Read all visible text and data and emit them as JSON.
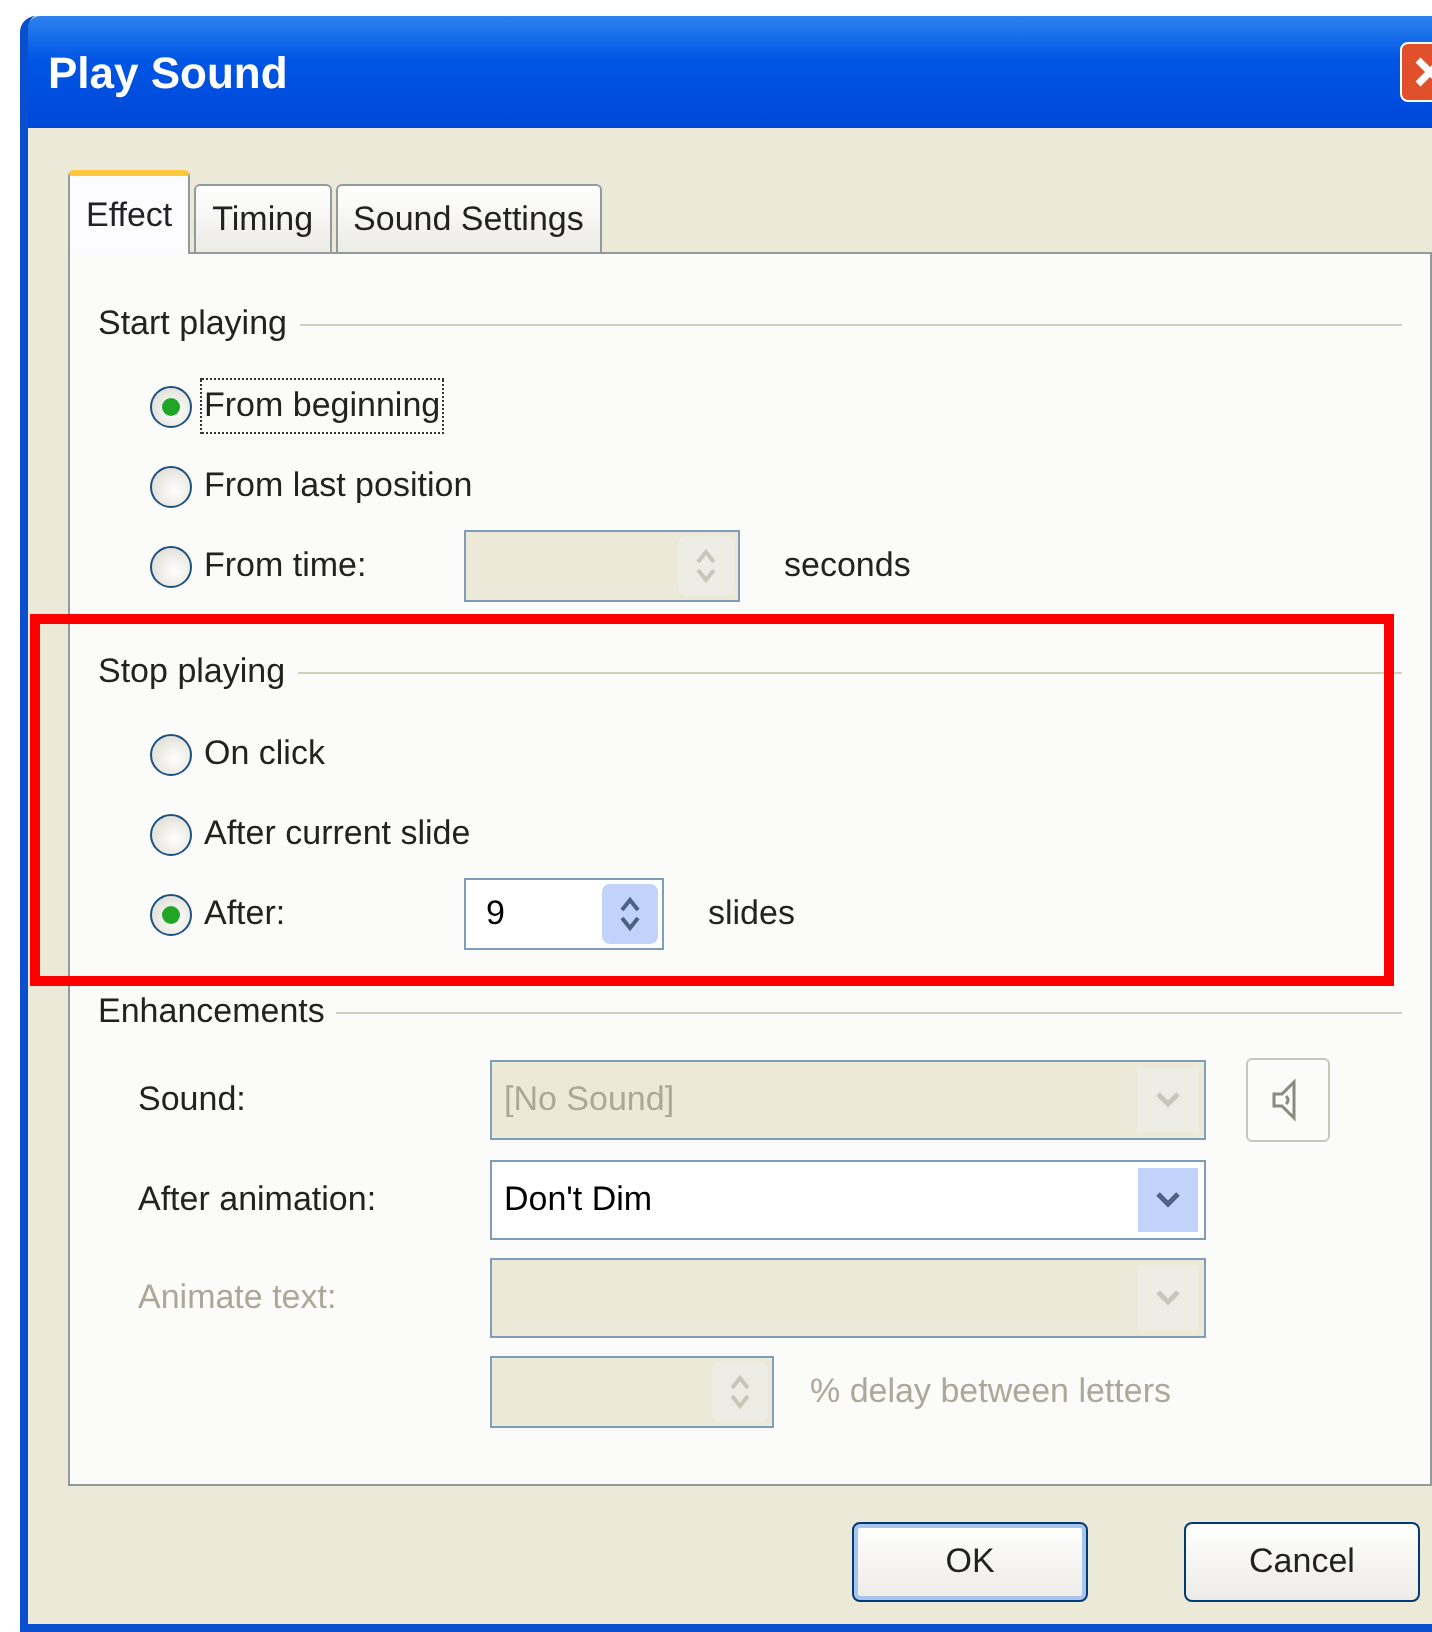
{
  "window": {
    "title": "Play Sound"
  },
  "tabs": [
    {
      "label": "Effect",
      "selected": true
    },
    {
      "label": "Timing",
      "selected": false
    },
    {
      "label": "Sound Settings",
      "selected": false
    }
  ],
  "start_playing": {
    "title": "Start playing",
    "options": [
      {
        "label": "From beginning",
        "selected": true,
        "focused": true
      },
      {
        "label": "From last position",
        "selected": false,
        "focused": false
      },
      {
        "label": "From time:",
        "selected": false,
        "focused": false,
        "spin": {
          "disabled": true
        },
        "suffix": "seconds"
      }
    ]
  },
  "stop_playing": {
    "title": "Stop playing",
    "highlighted": true,
    "options": [
      {
        "label": "On click",
        "selected": false,
        "focused": false
      },
      {
        "label": "After current slide",
        "selected": false,
        "focused": false
      },
      {
        "label": "After:",
        "selected": true,
        "focused": false,
        "spin": {
          "value": "9",
          "disabled": false
        },
        "suffix": "slides"
      }
    ]
  },
  "enhancements": {
    "title": "Enhancements",
    "rows": [
      {
        "label": "Sound:",
        "kind": "dropdown",
        "value": "[No Sound]",
        "disabled": true,
        "preview": {
          "disabled": true
        }
      },
      {
        "label": "After animation:",
        "kind": "dropdown",
        "value": "Don't Dim",
        "disabled": false
      },
      {
        "label": "Animate text:",
        "kind": "dropdown",
        "disabled": true
      }
    ],
    "delay": {
      "disabled": true,
      "suffix": "% delay between letters"
    }
  },
  "buttons": [
    {
      "label": "OK",
      "default": true
    },
    {
      "label": "Cancel",
      "default": false
    }
  ]
}
